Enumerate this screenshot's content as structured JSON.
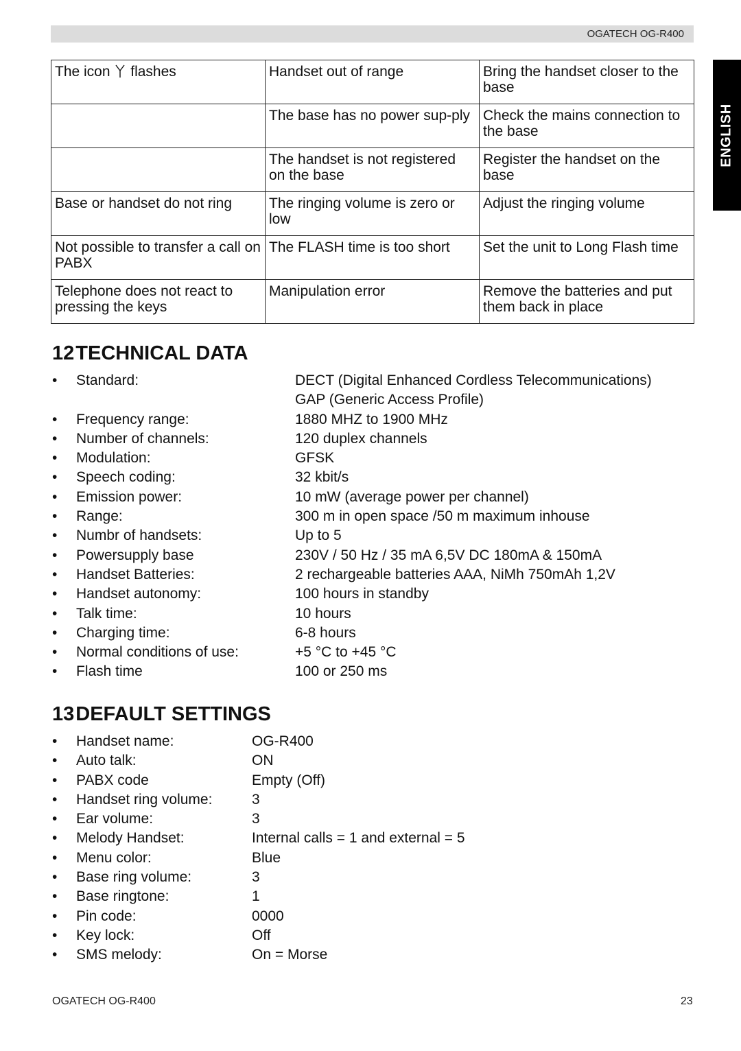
{
  "header": {
    "title": "OGATECH OG-R400"
  },
  "language_tab": "ENGLISH",
  "troubleshooting": {
    "rows": [
      {
        "problem_prefix": "The icon",
        "problem_icon": "antenna-icon",
        "problem_suffix": "flashes",
        "cause": "Handset out of range",
        "solution": "Bring the handset closer to the base"
      },
      {
        "problem": "",
        "cause": "The base has no power sup-ply",
        "solution": "Check the mains connection to the base"
      },
      {
        "problem": "",
        "cause": "The handset is not registered on the base",
        "solution": "Register the handset on the base"
      },
      {
        "problem": "Base or handset do not ring",
        "cause": "The ringing volume is zero or low",
        "solution": "Adjust the ringing volume"
      },
      {
        "problem": "Not possible to transfer a call on PABX",
        "cause": "The FLASH time is too short",
        "solution": "Set the unit to Long Flash time"
      },
      {
        "problem": "Telephone does not react to pressing the keys",
        "cause": "Manipulation error",
        "solution": "Remove the batteries and put them back in place"
      }
    ]
  },
  "technical_data": {
    "number": "12",
    "title": "TECHNICAL DATA",
    "items": [
      {
        "label": "Standard:",
        "value": "DECT (Digital Enhanced Cordless Telecommunications)"
      },
      {
        "label": "",
        "value": "GAP (Generic Access Profile)"
      },
      {
        "label": "Frequency range:",
        "value": "1880 MHZ to 1900 MHz"
      },
      {
        "label": "Number of channels:",
        "value": "120 duplex channels"
      },
      {
        "label": "Modulation:",
        "value": "GFSK"
      },
      {
        "label": "Speech coding:",
        "value": "32 kbit/s"
      },
      {
        "label": "Emission power:",
        "value": "10 mW (average power per channel)"
      },
      {
        "label": "Range:",
        "value": "300 m in open space /50 m maximum inhouse"
      },
      {
        "label": "Numbr of handsets:",
        "value": "Up to 5"
      },
      {
        "label": "Powersupply base",
        "value": "230V / 50 Hz / 35 mA 6,5V DC 180mA & 150mA"
      },
      {
        "label": "Handset Batteries:",
        "value": "2 rechargeable batteries AAA, NiMh 750mAh 1,2V"
      },
      {
        "label": "Handset autonomy:",
        "value": "100 hours in standby"
      },
      {
        "label": "Talk time:",
        "value": "10 hours"
      },
      {
        "label": "Charging time:",
        "value": "6-8 hours"
      },
      {
        "label": "Normal conditions of use:",
        "value": "+5 °C to +45 °C"
      },
      {
        "label": "Flash time",
        "value": "100 or 250 ms"
      }
    ]
  },
  "default_settings": {
    "number": "13",
    "title": "DEFAULT SETTINGS",
    "items": [
      {
        "label": "Handset name:",
        "value": "OG-R400"
      },
      {
        "label": "Auto talk:",
        "value": "ON"
      },
      {
        "label": "PABX code",
        "value": "Empty (Off)"
      },
      {
        "label": "Handset ring volume:",
        "value": "3"
      },
      {
        "label": "Ear volume:",
        "value": "3"
      },
      {
        "label": "Melody Handset:",
        "value": "Internal calls = 1 and external = 5"
      },
      {
        "label": "Menu color:",
        "value": "Blue"
      },
      {
        "label": "Base ring volume:",
        "value": "3"
      },
      {
        "label": "Base ringtone:",
        "value": "1"
      },
      {
        "label": "Pin code:",
        "value": "0000"
      },
      {
        "label": "Key lock:",
        "value": "Off"
      },
      {
        "label": "SMS melody:",
        "value": "On = Morse"
      }
    ]
  },
  "footer": {
    "left": "OGATECH OG-R400",
    "page_number": "23"
  },
  "bullet_char": "•"
}
